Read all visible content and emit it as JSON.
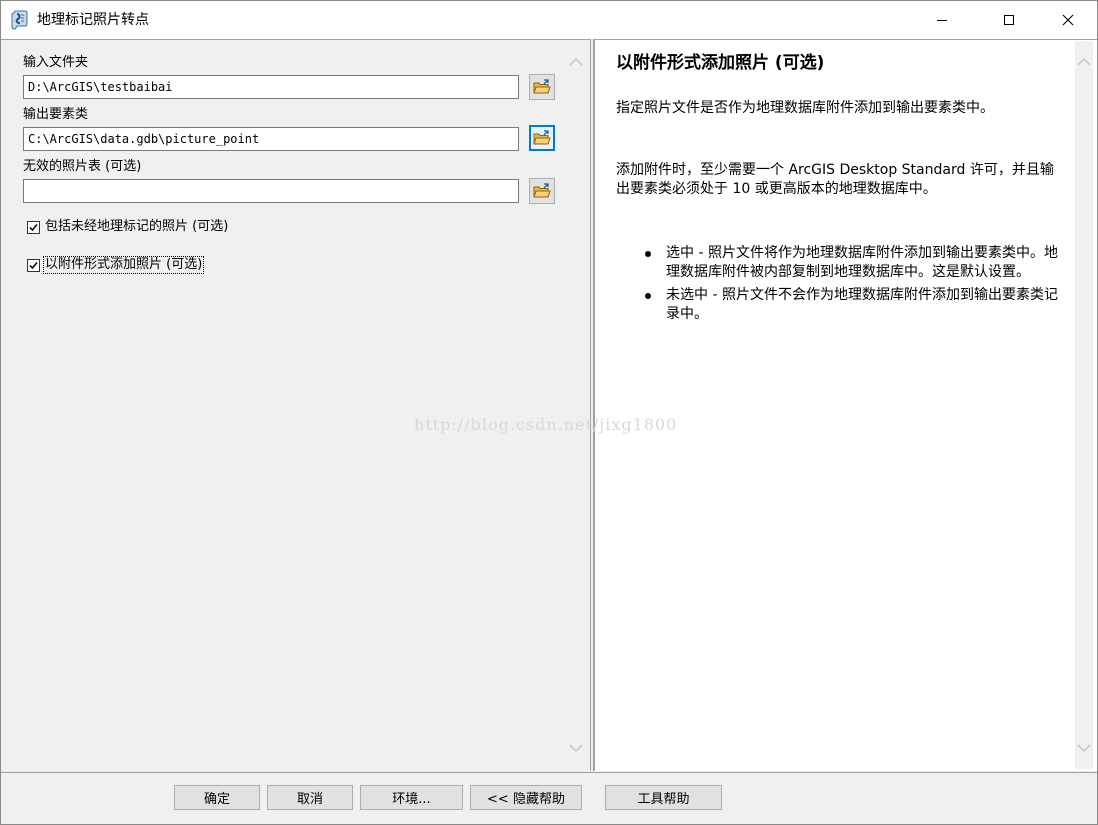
{
  "window": {
    "title": "地理标记照片转点"
  },
  "form": {
    "input_folder": {
      "label": "输入文件夹",
      "value": "D:\\ArcGIS\\testbaibai"
    },
    "output_features": {
      "label": "输出要素类",
      "value": "C:\\ArcGIS\\data.gdb\\picture_point"
    },
    "invalid_photos_table": {
      "label": "无效的照片表 (可选)",
      "value": ""
    },
    "include_non_geotagged": {
      "label": "包括未经地理标记的照片 (可选)",
      "checked": true
    },
    "add_as_attachments": {
      "label": "以附件形式添加照片 (可选)",
      "checked": true
    }
  },
  "help": {
    "title": "以附件形式添加照片 (可选)",
    "paragraph1": "指定照片文件是否作为地理数据库附件添加到输出要素类中。",
    "paragraph2": "添加附件时，至少需要一个 ArcGIS Desktop Standard 许可，并且输出要素类必须处于 10 或更高版本的地理数据库中。",
    "bullets": [
      "选中 - 照片文件将作为地理数据库附件添加到输出要素类中。地理数据库附件被内部复制到地理数据库中。这是默认设置。",
      "未选中 - 照片文件不会作为地理数据库附件添加到输出要素类记录中。"
    ]
  },
  "watermark": "http://blog.csdn.net/jixg1800",
  "buttons": {
    "ok": "确定",
    "cancel": "取消",
    "environments": "环境...",
    "hide_help": "<< 隐藏帮助",
    "tool_help": "工具帮助"
  },
  "icons": {
    "app": "toolbox-script-icon",
    "browse": "open-folder-icon"
  },
  "colors": {
    "focus_blue": "#0078d7",
    "panel_bg": "#f0f0f0"
  }
}
